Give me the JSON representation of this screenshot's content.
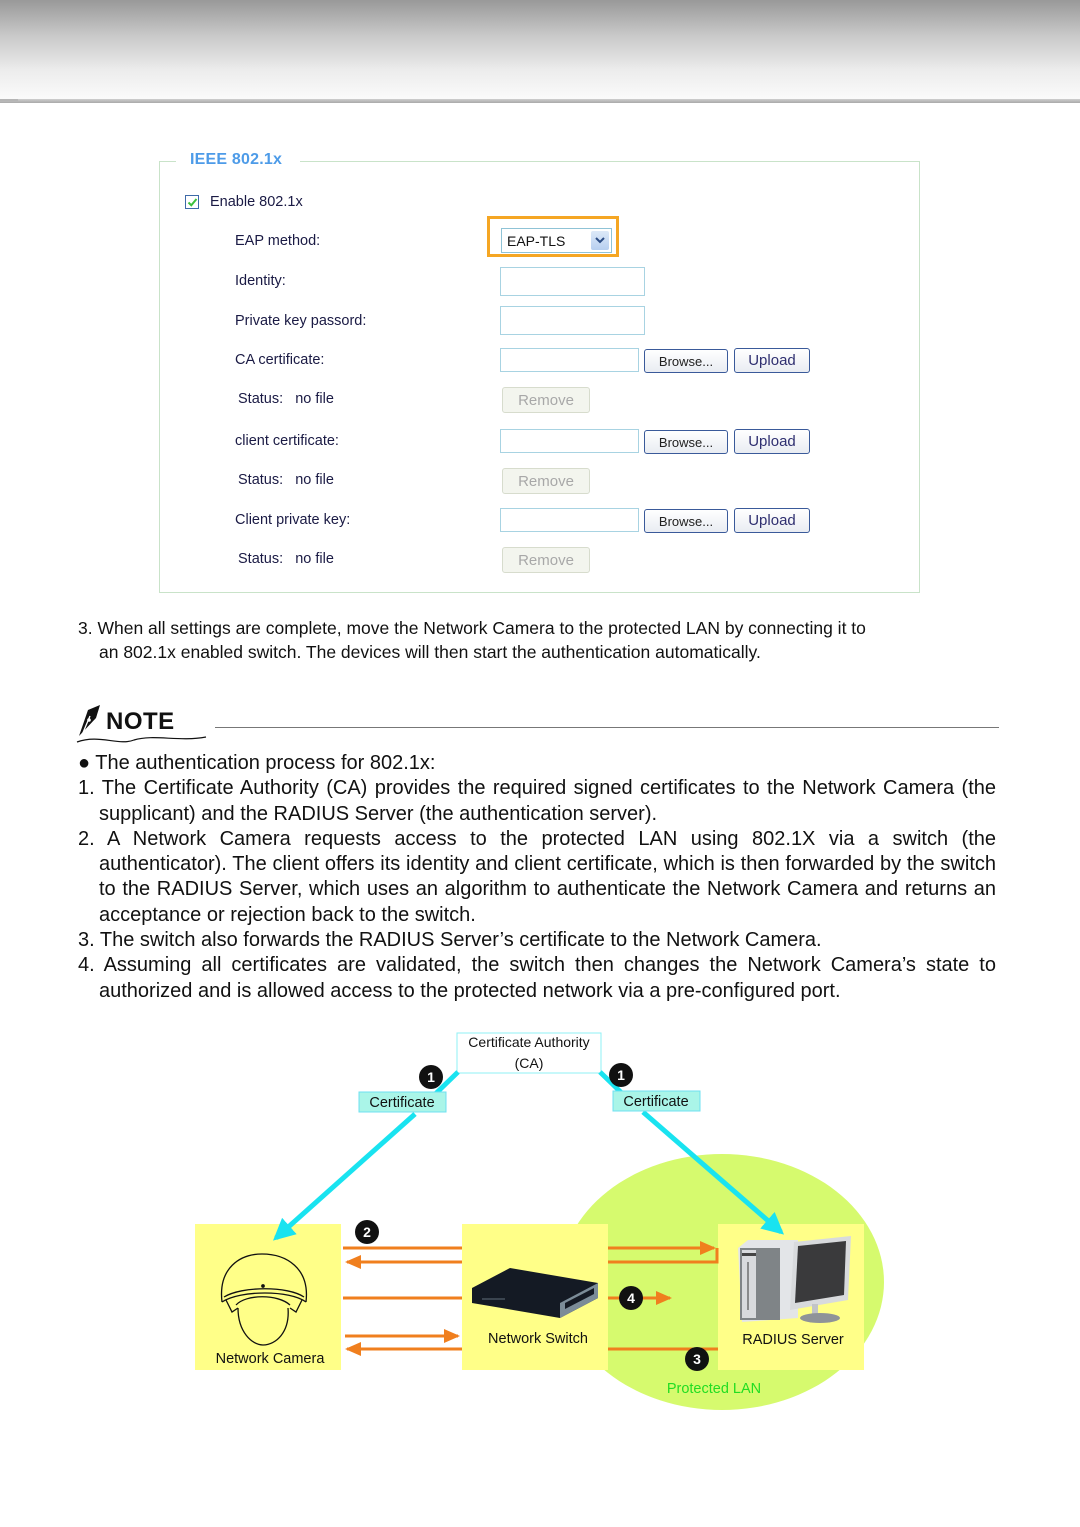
{
  "form": {
    "legend": "IEEE 802.1x",
    "enable_label": "Enable 802.1x",
    "enable_checked": true,
    "eap_method_label": "EAP method:",
    "eap_method_value": "EAP-TLS",
    "identity_label": "Identity:",
    "identity_value": "",
    "private_key_password_label": "Private key passord:",
    "private_key_password_value": "",
    "ca_certificate_label": "CA certificate:",
    "client_certificate_label": "client certificate:",
    "client_private_key_label": "Client private key:",
    "status_label": "Status:",
    "status_value": "no file",
    "browse_label": "Browse...",
    "upload_label": "Upload",
    "remove_label": "Remove",
    "highlight_color": "#f5a623"
  },
  "step3": {
    "line1": "3. When all settings are complete, move the Network Camera to the protected LAN by connecting it to",
    "line2": "an 802.1x enabled switch. The devices will then start the authentication automatically."
  },
  "note": {
    "title": "NOTE",
    "intro": "● The authentication process for 802.1x:",
    "items": [
      "1. The Certificate Authority (CA) provides the required signed certificates to the Network Camera (the supplicant) and the RADIUS Server (the authentication server).",
      "2. A Network Camera requests access to the protected LAN using 802.1X via a switch (the authenticator).  The client offers its identity and client certificate, which is then forwarded by the switch to the RADIUS Server, which uses an algorithm to authenticate the Network Camera and returns an acceptance or rejection back to the switch.",
      "3. The switch also forwards the RADIUS Server’s certificate to the Network Camera.",
      "4. Assuming all certificates are validated, the switch then changes the Network Camera’s state to authorized and is allowed access to the protected network via a pre-configured port."
    ]
  },
  "diagram": {
    "ca_line1": "Certificate Authority",
    "ca_line2": "(CA)",
    "certificate_left": "Certificate",
    "certificate_right": "Certificate",
    "camera_label": "Network Camera",
    "switch_label": "Network Switch",
    "radius_label": "RADIUS Server",
    "protected_lan_label": "Protected LAN",
    "step_badges": [
      "1",
      "1",
      "2",
      "3",
      "4"
    ],
    "colors": {
      "certificate_arrow": "#19e3f0",
      "message_arrow": "#f07f1e",
      "device_box": "#ffff88",
      "protected_lan": "#d6fa6e",
      "protected_lan_text": "#22dd22"
    }
  }
}
